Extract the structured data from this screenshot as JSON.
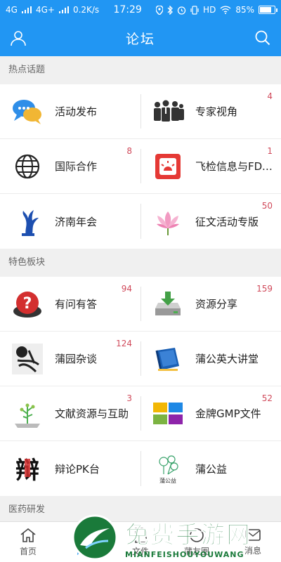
{
  "status": {
    "net1": "4G",
    "net2": "4G+",
    "speed": "0.2K/s",
    "time": "17:29",
    "hd": "HD",
    "battery": "85%",
    "battery_level": 0.85
  },
  "header": {
    "title": "论坛"
  },
  "sections": [
    {
      "title": "热点话题",
      "rows": [
        [
          {
            "label": "活动发布",
            "count": "",
            "icon": "chat-bubbles-icon"
          },
          {
            "label": "专家视角",
            "count": "4",
            "icon": "experts-icon"
          }
        ],
        [
          {
            "label": "国际合作",
            "count": "8",
            "icon": "globe-icon"
          },
          {
            "label": "飞检信息与FDA…",
            "count": "1",
            "icon": "alarm-icon"
          }
        ],
        [
          {
            "label": "济南年会",
            "count": "",
            "icon": "sculpture-icon"
          },
          {
            "label": "征文活动专版",
            "count": "50",
            "icon": "lotus-icon"
          }
        ]
      ]
    },
    {
      "title": "特色板块",
      "rows": [
        [
          {
            "label": "有问有答",
            "count": "94",
            "icon": "question-icon"
          },
          {
            "label": "资源分享",
            "count": "159",
            "icon": "download-drive-icon"
          }
        ],
        [
          {
            "label": "蒲园杂谈",
            "count": "124",
            "icon": "calligraphy-icon"
          },
          {
            "label": "蒲公英大讲堂",
            "count": "",
            "icon": "book-icon"
          }
        ],
        [
          {
            "label": "文献资源与互助",
            "count": "3",
            "icon": "plant-book-icon"
          },
          {
            "label": "金牌GMP文件",
            "count": "52",
            "icon": "folders-icon"
          }
        ],
        [
          {
            "label": "辩论PK台",
            "count": "",
            "icon": "debate-icon"
          },
          {
            "label": "蒲公益",
            "count": "",
            "icon": "dandelion-icon"
          }
        ]
      ]
    },
    {
      "title": "医药研发",
      "rows": []
    }
  ],
  "tabs": [
    {
      "label": "首页",
      "icon": "home-icon"
    },
    {
      "label": "论坛",
      "icon": "forum-icon"
    },
    {
      "label": "文件",
      "icon": "file-icon"
    },
    {
      "label": "蒲友圈",
      "icon": "circle-icon"
    },
    {
      "label": "消息",
      "icon": "message-icon"
    }
  ],
  "watermark": {
    "main": "免费手游网",
    "sub": "MIANFEISHOUYOUWANG"
  },
  "colors": {
    "primary": "#2196f3",
    "count": "#d0495a",
    "watermark": "#1a7a3a"
  }
}
